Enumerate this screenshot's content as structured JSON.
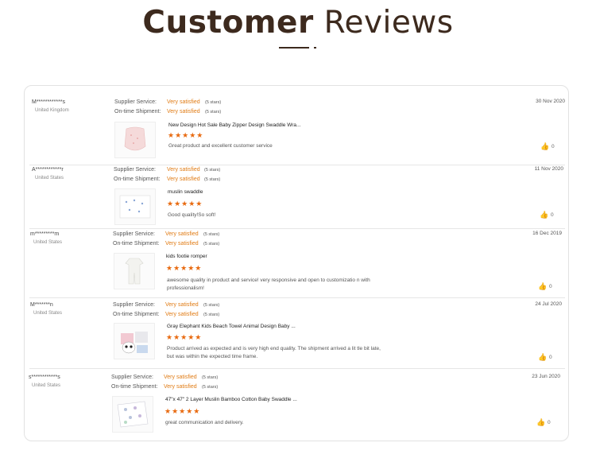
{
  "header": {
    "title_bold": "Customer",
    "title_rest": "Reviews"
  },
  "labels": {
    "supplier": "Supplier Service:",
    "shipment": "On-time Shipment:"
  },
  "reviews": [
    {
      "name": "M************s",
      "country": "United Kingdom",
      "date": "30 Nov 2020",
      "supplier_rating": "Very satisfied",
      "supplier_stars": "(5 stars)",
      "shipment_rating": "Very satisfied",
      "shipment_stars": "(5 stars)",
      "product": "New Design Hot Sale Baby Zipper Design Swaddle Wra...",
      "stars": "★★★★★",
      "comment": "Great product and excellent customer service",
      "likes": "0"
    },
    {
      "name": "A************r",
      "country": "United States",
      "date": "11 Nov 2020",
      "supplier_rating": "Very satisfied",
      "supplier_stars": "(5 stars)",
      "shipment_rating": "Very satisfied",
      "shipment_stars": "(5 stars)",
      "product": "muslin swaddle",
      "stars": "★★★★★",
      "comment": "Good quality!So soft!",
      "likes": "0"
    },
    {
      "name": "m*********m",
      "country": "United States",
      "date": "16 Dec 2019",
      "supplier_rating": "Very satisfied",
      "supplier_stars": "(5 stars)",
      "shipment_rating": "Very satisfied",
      "shipment_stars": "(5 stars)",
      "product": "kids footie romper",
      "stars": "★★★★★",
      "comment": "awesome quality in product and service! very responsive and open to customizatio n with professionalism!",
      "likes": "0"
    },
    {
      "name": "M*******n",
      "country": "United States",
      "date": "24 Jul 2020",
      "supplier_rating": "Very satisfied",
      "supplier_stars": "(5 stars)",
      "shipment_rating": "Very satisfied",
      "shipment_stars": "(5 stars)",
      "product": "Gray Elephant Kids Beach Towel Animal Design Baby ...",
      "stars": "★★★★★",
      "comment": "Product arrived as expected and is very high end quality. The shipment arrived a lit tle bit late, but was within the expected time frame.",
      "likes": "0"
    },
    {
      "name": "s************s",
      "country": "United States",
      "date": "23 Jun 2020",
      "supplier_rating": "Very satisfied",
      "supplier_stars": "(5 stars)",
      "shipment_rating": "Very satisfied",
      "shipment_stars": "(5 stars)",
      "product": "47\"x 47\" 2 Layer Muslin Bamboo Cotton Baby Swaddle ...",
      "stars": "★★★★★",
      "comment": "great communication and delivery.",
      "likes": "0"
    }
  ]
}
